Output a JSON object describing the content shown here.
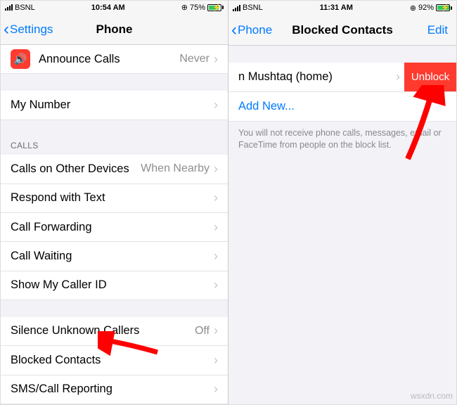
{
  "left": {
    "status": {
      "carrier": "BSNL",
      "time": "10:54 AM",
      "batteryPct": "75%"
    },
    "nav": {
      "back": "Settings",
      "title": "Phone"
    },
    "announce": {
      "label": "Announce Calls",
      "value": "Never"
    },
    "myNumber": "My Number",
    "callsHeader": "CALLS",
    "rows": {
      "otherDevices": {
        "label": "Calls on Other Devices",
        "value": "When Nearby"
      },
      "respond": "Respond with Text",
      "forwarding": "Call Forwarding",
      "waiting": "Call Waiting",
      "callerId": "Show My Caller ID"
    },
    "silence": {
      "label": "Silence Unknown Callers",
      "value": "Off"
    },
    "blocked": "Blocked Contacts",
    "smsReport": "SMS/Call Reporting"
  },
  "right": {
    "status": {
      "carrier": "BSNL",
      "time": "11:31 AM",
      "batteryPct": "92%"
    },
    "nav": {
      "back": "Phone",
      "title": "Blocked Contacts",
      "edit": "Edit"
    },
    "entry": "n Mushtaq (home)",
    "unblock": "Unblock",
    "addNew": "Add New...",
    "footnote": "You will not receive phone calls, messages, email or FaceTime from people on the block list."
  },
  "watermark": "wsxdn.com"
}
